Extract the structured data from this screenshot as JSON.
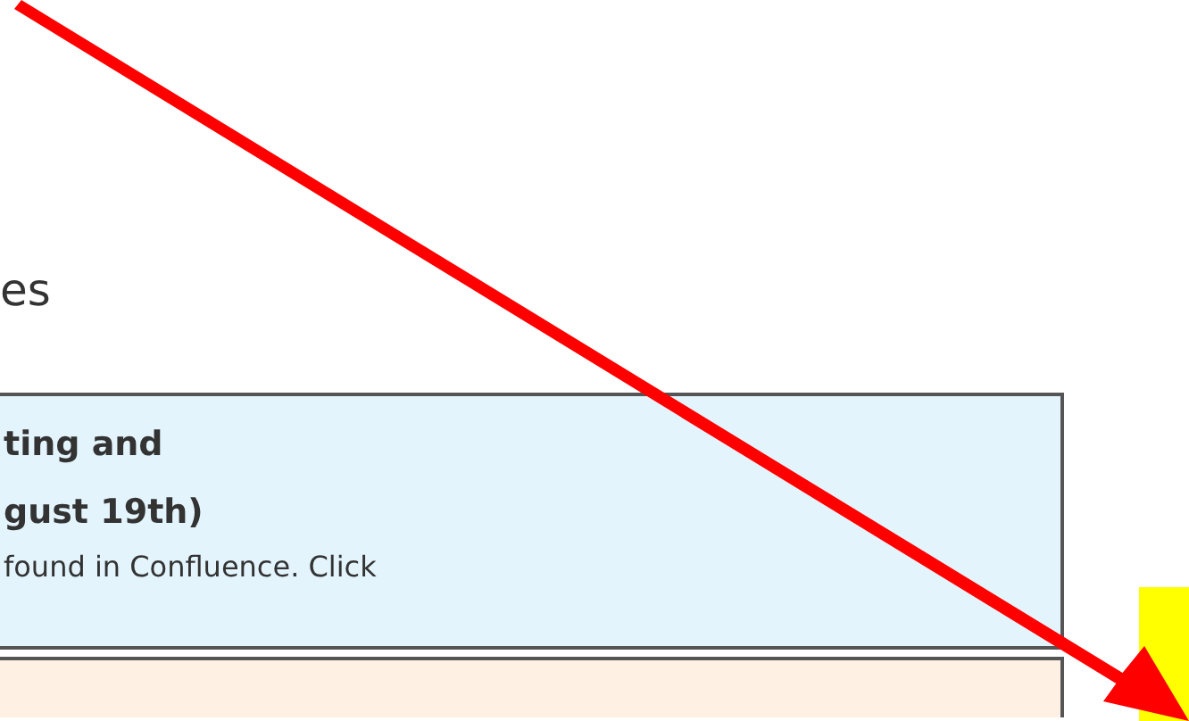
{
  "heading": "es",
  "notices": [
    {
      "kind": "info",
      "title_lines": [
        "ting and",
        "gust 19th)"
      ],
      "body": "found in Confluence. Click"
    },
    {
      "kind": "warning"
    }
  ],
  "arrow_annotation": true,
  "highlight_mark": true
}
